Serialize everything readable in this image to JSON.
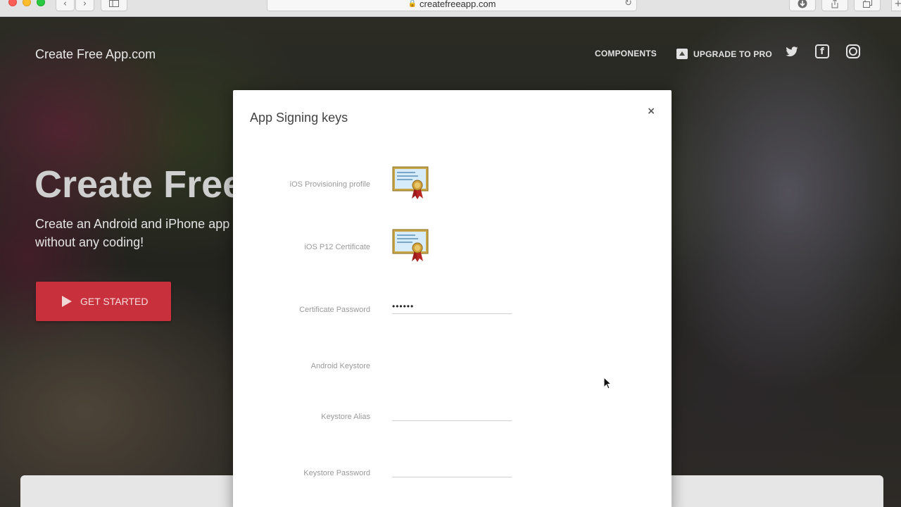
{
  "browser": {
    "url": "createfreeapp.com",
    "back_glyph": "‹",
    "forward_glyph": "›"
  },
  "site": {
    "brand": "Create Free App.com",
    "nav": {
      "components": "COMPONENTS",
      "upgrade": "UPGRADE TO PRO"
    },
    "social": [
      "twitter-icon",
      "facebook-icon",
      "instagram-icon"
    ],
    "hero": {
      "title": "Create Free",
      "subtitle": "Create an Android and iPhone app without any coding!",
      "cta_label": "GET STARTED"
    }
  },
  "modal": {
    "title": "App Signing keys",
    "close_label": "×",
    "fields": {
      "ios_profile_label": "iOS Provisioning profile",
      "ios_p12_label": "iOS P12 Certificate",
      "cert_password_label": "Certificate Password",
      "cert_password_value": "••••••",
      "android_keystore_label": "Android Keystore",
      "keystore_alias_label": "Keystore Alias",
      "keystore_alias_value": "",
      "keystore_password_label": "Keystore Password",
      "keystore_password_value": ""
    }
  },
  "colors": {
    "cta": "#c8303b",
    "modal_bg": "#ffffff",
    "label": "#9a9a9a"
  }
}
